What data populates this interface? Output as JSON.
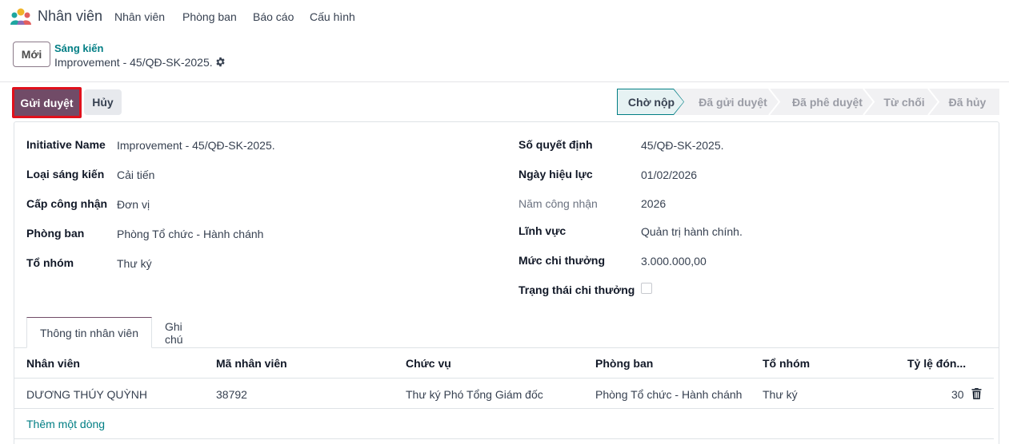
{
  "app": {
    "title": "Nhân viên",
    "logo_icon": "people-icon",
    "menu": [
      "Nhân viên",
      "Phòng ban",
      "Báo cáo",
      "Cấu hình"
    ]
  },
  "control_panel": {
    "new_button": "Mới",
    "breadcrumb_parent": "Sáng kiến",
    "breadcrumb_current": "Improvement - 45/QĐ-SK-2025.",
    "settings_icon": "gear-icon"
  },
  "actions": {
    "submit": "Gửi duyệt",
    "cancel": "Hủy"
  },
  "statusbar": {
    "stages": [
      "Chờ nộp",
      "Đã gửi duyệt",
      "Đã phê duyệt",
      "Từ chối",
      "Đã hủy"
    ],
    "active": "Chờ nộp"
  },
  "form": {
    "left": [
      {
        "label": "Initiative Name",
        "value": "Improvement - 45/QĐ-SK-2025."
      },
      {
        "label": "Loại sáng kiến",
        "value": "Cải tiến"
      },
      {
        "label": "Cấp công nhận",
        "value": "Đơn vị"
      },
      {
        "label": "Phòng ban",
        "value": "Phòng Tổ chức - Hành chánh"
      },
      {
        "label": "Tổ nhóm",
        "value": "Thư ký"
      }
    ],
    "right": [
      {
        "label": "Số quyết định",
        "value": "45/QĐ-SK-2025."
      },
      {
        "label": "Ngày hiệu lực",
        "value": "01/02/2026"
      },
      {
        "label": "Năm công nhận",
        "value": "2026"
      },
      {
        "label": "Lĩnh vực",
        "value": "Quản trị hành chính."
      },
      {
        "label": "Mức chi thưởng",
        "value": "3.000.000,00"
      },
      {
        "label": "Trạng thái chi thưởng",
        "value": ""
      }
    ],
    "reward_status_checked": false
  },
  "tabs": [
    "Thông tin nhân viên",
    "Ghi chú"
  ],
  "table": {
    "headers": [
      "Nhân viên",
      "Mã nhân viên",
      "Chức vụ",
      "Phòng ban",
      "Tổ nhóm",
      "Tỷ lệ đón..."
    ],
    "rows": [
      [
        "DƯƠNG THÚY QUỲNH",
        "38792",
        "Thư ký Phó Tổng Giám đốc",
        "Phòng Tổ chức - Hành chánh",
        "Thư ký",
        "30"
      ]
    ],
    "add_line": "Thêm một dòng",
    "delete_icon": "trash-icon"
  },
  "colors": {
    "brand": "#714b67",
    "link": "#017e84",
    "highlight_border": "#e0101c"
  }
}
